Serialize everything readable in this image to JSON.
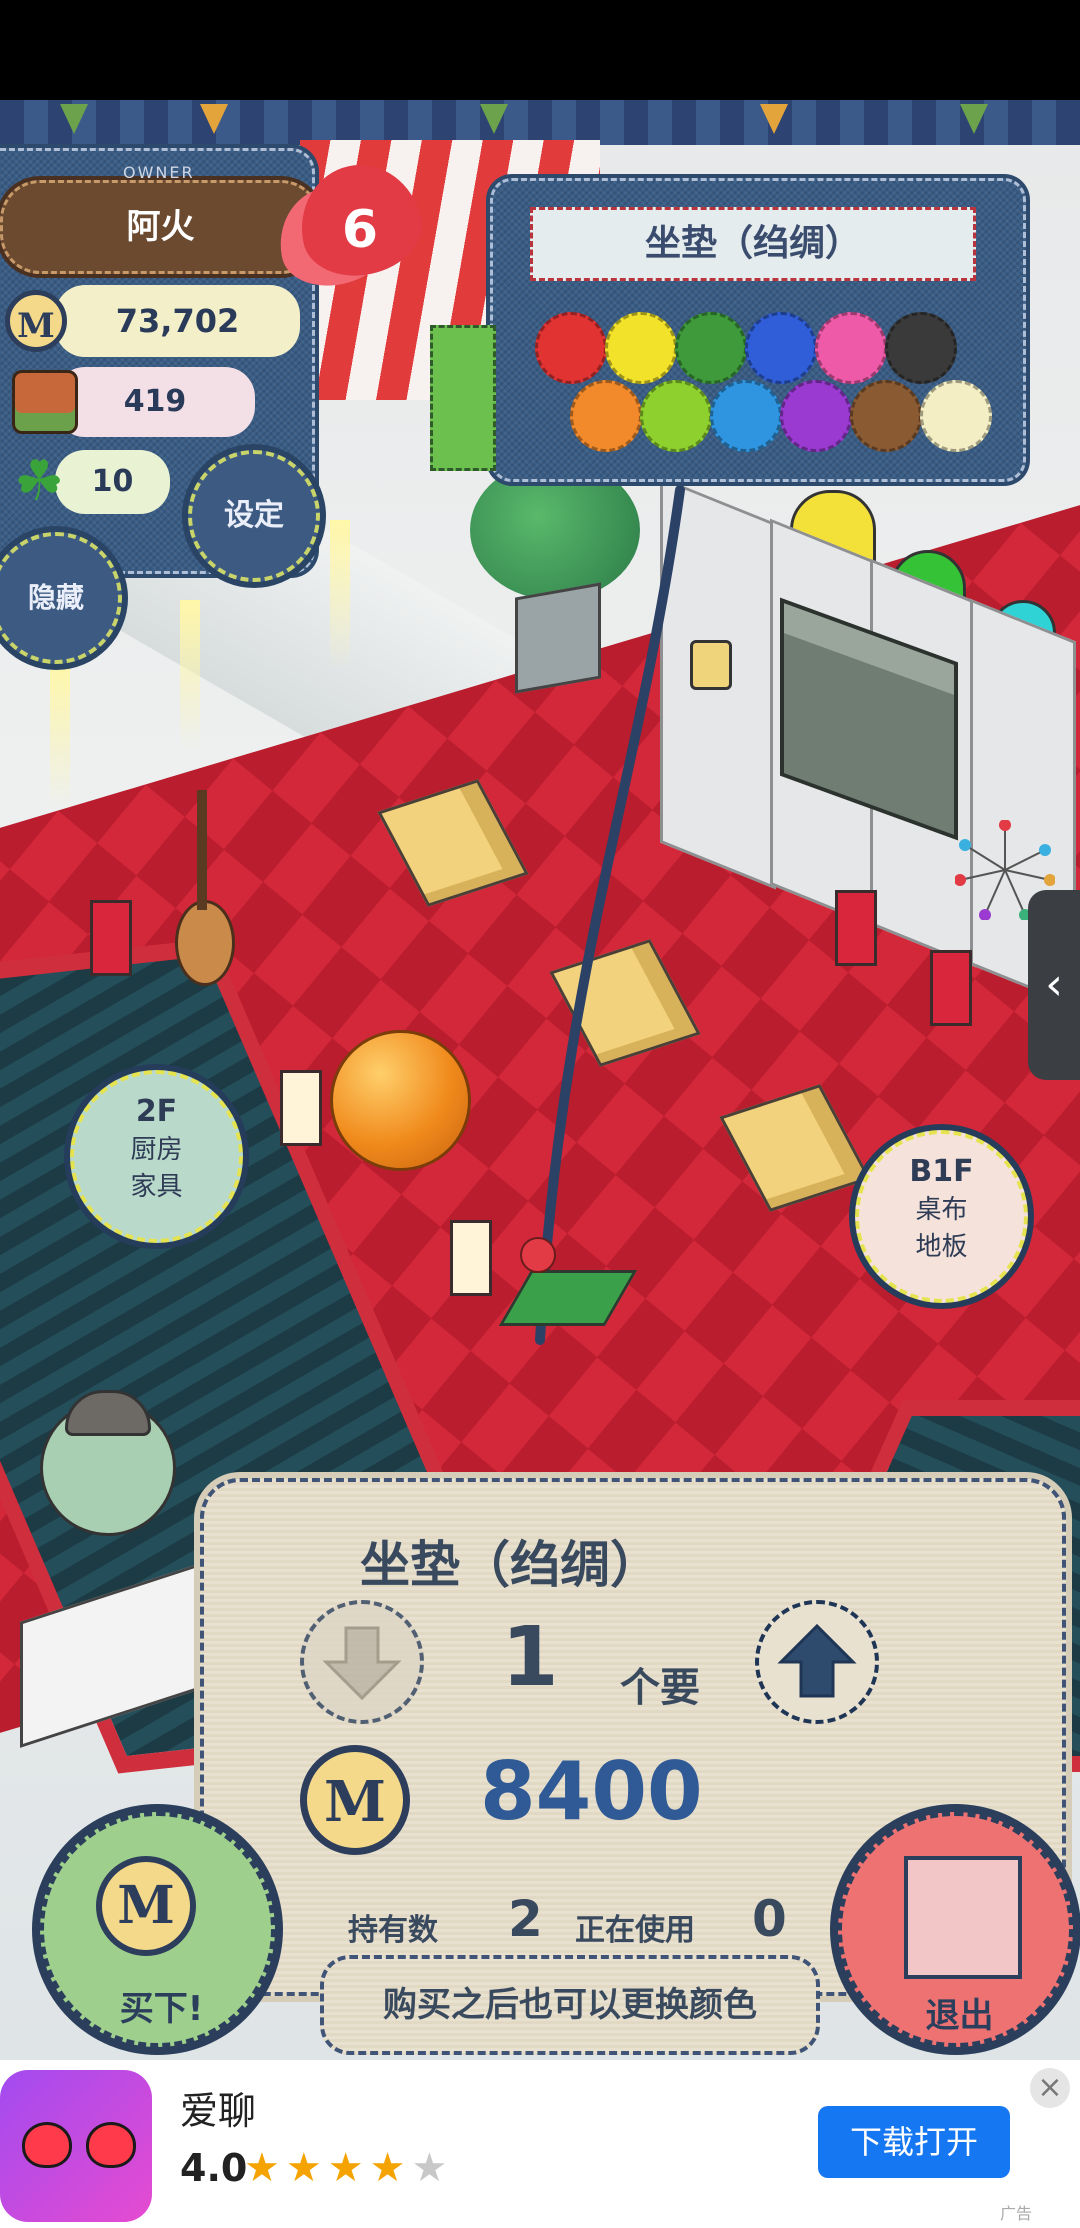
{
  "owner": {
    "small_label": "OWNER",
    "name": "阿火",
    "coins": "73,702",
    "supplies": "419",
    "clovers": "10",
    "settings_label": "设定",
    "hide_label": "隐藏",
    "hearts": "6"
  },
  "coin_symbol": "M",
  "color_picker": {
    "title": "坐垫（绉绸）",
    "colors": [
      "#e23333",
      "#f2e22a",
      "#3e9a3a",
      "#2f5ed8",
      "#ef5aa8",
      "#3a3a3a",
      "#f28a2b",
      "#8ed12f",
      "#2f95e0",
      "#9a3ad1",
      "#8a5a32",
      "#f3eec4"
    ]
  },
  "floor_bubbles": {
    "up": {
      "floor": "2F",
      "line1": "厨房",
      "line2": "家具"
    },
    "down": {
      "floor": "B1F",
      "line1": "桌布",
      "line2": "地板"
    }
  },
  "purchase": {
    "item_name": "坐垫（绉绸）",
    "quantity": "1",
    "unit_label": "个要",
    "price": "8400",
    "owned_label": "持有数",
    "owned_count": "2",
    "in_use_label": "正在使用",
    "in_use_count": "0",
    "note": "购买之后也可以更换颜色",
    "buy_label": "买下!",
    "exit_label": "退出"
  },
  "ad": {
    "app_name": "爱聊",
    "rating": "4.0",
    "stars_filled": 4,
    "stars_total": 5,
    "cta": "下载打开",
    "ad_label": "广告",
    "close": "×"
  },
  "side_handle": "‹"
}
